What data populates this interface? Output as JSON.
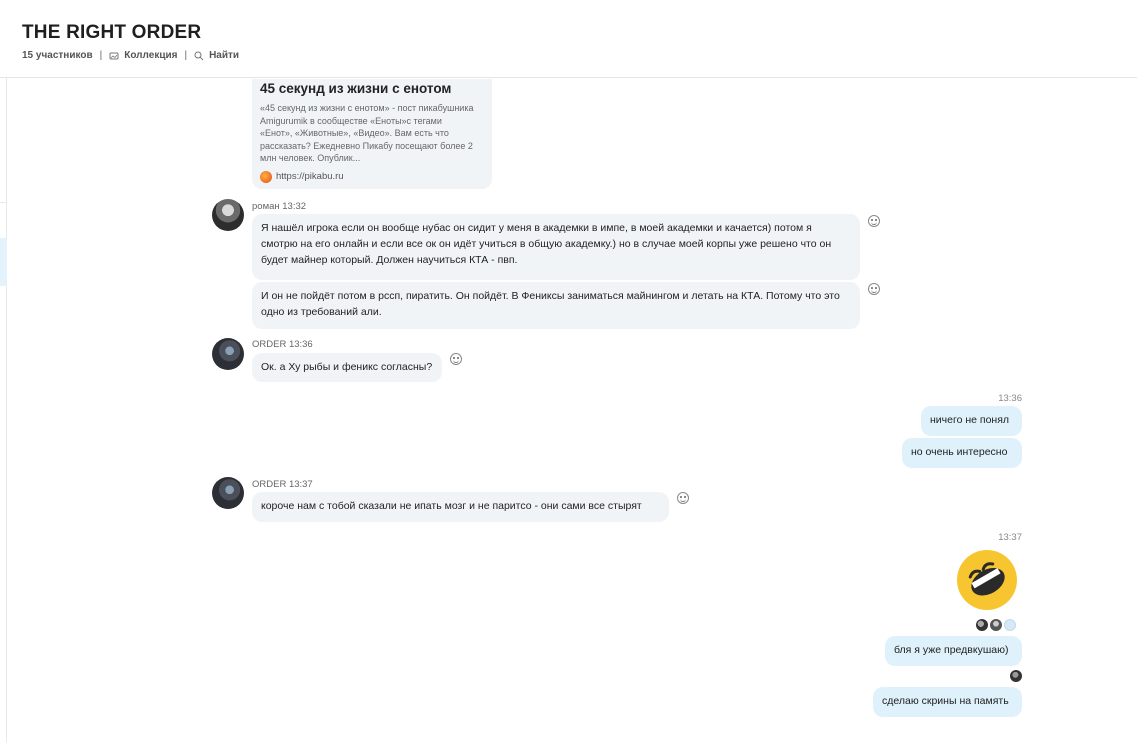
{
  "header": {
    "title": "THE RIGHT ORDER",
    "participants": "15 участников",
    "collection_label": "Коллекция",
    "search_label": "Найти",
    "separator": "|"
  },
  "link_card": {
    "title": "45 секунд из жизни с енотом",
    "description": "«45 секунд из жизни с енотом» - пост пикабушника Amigurumik в сообществе «Еноты»с тегами «Енот», «Животные», «Видео». Вам есть что рассказать? Ежедневно Пикабу посещают более 2 млн человек. Опублик...",
    "url": "https://pikabu.ru"
  },
  "messages": {
    "m1": {
      "sender": "роман 13:32",
      "text": "Я нашёл игрока если он вообще нубас он сидит у меня в академки в импе, в моей академки и качается) потом  я смотрю на его онлайн и если все ок он идёт учиться в общую академку.) но в случае моей корпы уже решено что он будет майнер который. Должен научиться КТА - пвп."
    },
    "m2": {
      "text": "И он не пойдёт потом в рссп, пиратить. Он пойдёт. В Фениксы заниматься майнингом и летать на КТА. Потому что это одно из требований али."
    },
    "m3": {
      "sender": "ORDER 13:36",
      "text": "Ок. а Ху рыбы и феникс согласны?"
    },
    "m4": {
      "time": "13:36",
      "text": "ничего не понял"
    },
    "m5": {
      "text": "но очень интересно"
    },
    "m6": {
      "sender": "ORDER 13:37",
      "text": "короче нам с тобой сказали  не ипать мозг и не паритсо  - они сами все стырят"
    },
    "m7": {
      "time": "13:37"
    },
    "m8": {
      "text": "бля я уже предвкушаю)"
    },
    "m9": {
      "text": "сделаю скрины на память"
    }
  },
  "colors": {
    "incoming_bubble": "#f1f4f7",
    "outgoing_bubble": "#dff1fb",
    "emoji_yellow": "#f7c530"
  }
}
